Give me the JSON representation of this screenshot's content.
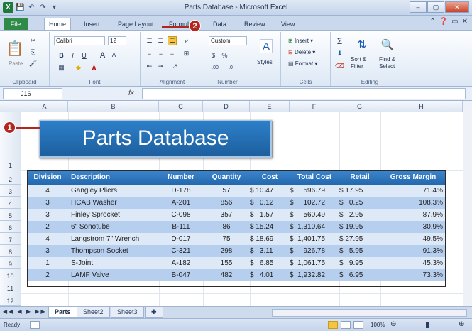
{
  "window": {
    "title": "Parts Database - Microsoft Excel",
    "app_icon": "X"
  },
  "qat": {
    "save_icon": "💾",
    "undo_icon": "↶",
    "redo_icon": "↷",
    "more_icon": "▾"
  },
  "window_buttons": {
    "minimize": "–",
    "maximize": "▢",
    "close": "✕"
  },
  "tabs": [
    "File",
    "Home",
    "Insert",
    "Page Layout",
    "Formulas",
    "Data",
    "Review",
    "View"
  ],
  "ribbon": {
    "clipboard": {
      "paste": "Paste",
      "label": "Clipboard"
    },
    "font": {
      "name": "Calibri",
      "size": "12",
      "bold": "B",
      "italic": "I",
      "underline": "U",
      "grow": "A",
      "shrink": "A",
      "label": "Font"
    },
    "alignment": {
      "label": "Alignment"
    },
    "number": {
      "format": "Custom",
      "currency": "$",
      "percent": "%",
      "comma": ",",
      "inc_dec": ".00",
      "dec_dec": ".0",
      "label": "Number"
    },
    "styles": {
      "label": "Styles"
    },
    "cells": {
      "insert": "Insert",
      "delete": "Delete",
      "format": "Format",
      "label": "Cells"
    },
    "editing": {
      "sigma": "Σ",
      "sort": "Sort &",
      "filter": "Filter",
      "find": "Find &",
      "select": "Select",
      "label": "Editing"
    }
  },
  "formula_bar": {
    "name_box": "J16",
    "fx": "fx",
    "value": ""
  },
  "columns": [
    "A",
    "B",
    "C",
    "D",
    "E",
    "F",
    "G",
    "H"
  ],
  "rows": [
    "1",
    "2",
    "3",
    "4",
    "5",
    "6",
    "7",
    "8",
    "9",
    "10",
    "11",
    "12"
  ],
  "banner_title": "Parts Database",
  "table": {
    "headers": [
      "Division",
      "Description",
      "Number",
      "Quantity",
      "Cost",
      "Total Cost",
      "Retail",
      "Gross Margin"
    ],
    "rows": [
      [
        "4",
        "Gangley Pliers",
        "D-178",
        "57",
        "$ 10.47",
        "$     596.79",
        "$ 17.95",
        "71.4%"
      ],
      [
        "3",
        "HCAB Washer",
        "A-201",
        "856",
        "$   0.12",
        "$     102.72",
        "$   0.25",
        "108.3%"
      ],
      [
        "3",
        "Finley Sprocket",
        "C-098",
        "357",
        "$   1.57",
        "$     560.49",
        "$   2.95",
        "87.9%"
      ],
      [
        "2",
        "6\" Sonotube",
        "B-111",
        "86",
        "$ 15.24",
        "$  1,310.64",
        "$ 19.95",
        "30.9%"
      ],
      [
        "4",
        "Langstrom 7\" Wrench",
        "D-017",
        "75",
        "$ 18.69",
        "$  1,401.75",
        "$ 27.95",
        "49.5%"
      ],
      [
        "3",
        "Thompson Socket",
        "C-321",
        "298",
        "$   3.11",
        "$     926.78",
        "$   5.95",
        "91.3%"
      ],
      [
        "1",
        "S-Joint",
        "A-182",
        "155",
        "$   6.85",
        "$  1,061.75",
        "$   9.95",
        "45.3%"
      ],
      [
        "2",
        "LAMF Valve",
        "B-047",
        "482",
        "$   4.01",
        "$  1,932.82",
        "$   6.95",
        "73.3%"
      ]
    ]
  },
  "sheets": [
    "Parts",
    "Sheet2",
    "Sheet3"
  ],
  "status": {
    "mode": "Ready",
    "zoom": "100%"
  },
  "callouts": {
    "one": "1",
    "two": "2"
  }
}
